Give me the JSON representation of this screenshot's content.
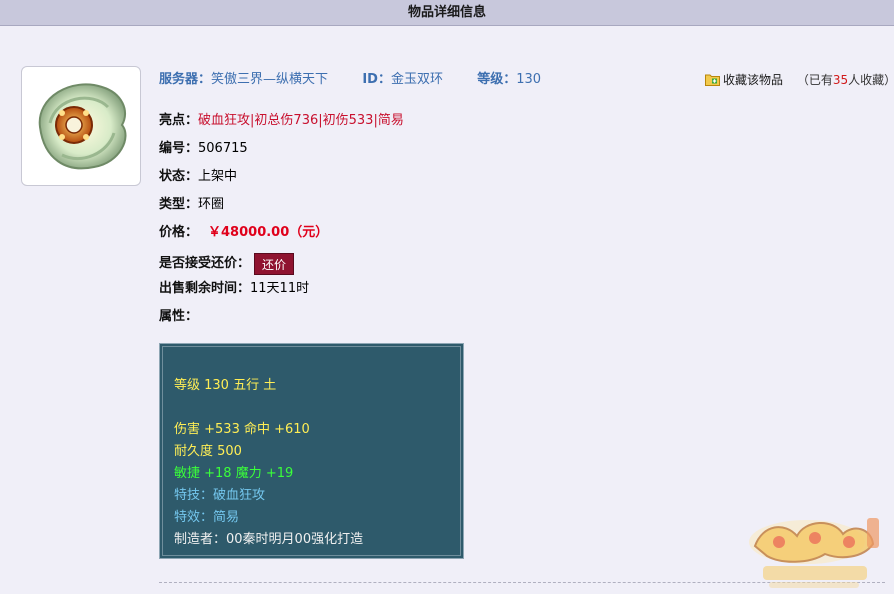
{
  "page": {
    "title": "物品详细信息"
  },
  "header": {
    "server_label": "服务器：",
    "server_value": "笑傲三界—纵横天下",
    "id_label": "ID：",
    "id_value": "金玉双环",
    "level_label": "等级：",
    "level_value": "130"
  },
  "favorite": {
    "link_label": "收藏该物品",
    "count_prefix": "（已有",
    "count": "35",
    "count_suffix": "人收藏）",
    "icon": "folder-add-icon"
  },
  "details": {
    "highlights_label": "亮点：",
    "highlights": [
      "破血狂攻",
      "初总伤736",
      "初伤533",
      "简易"
    ],
    "highlight_sep": "|",
    "serial_label": "编号：",
    "serial_value": "506715",
    "status_label": "状态：",
    "status_value": "上架中",
    "type_label": "类型：",
    "type_value": "环圈",
    "price_label": "价格：",
    "price_value": "￥48000.00（元）",
    "bargain_label": "是否接受还价：",
    "bargain_button": "还价",
    "remaining_label": "出售剩余时间：",
    "remaining_value": "11天11时",
    "attributes_label": "属性："
  },
  "attributes": {
    "line1": "等级 130 五行 土",
    "line2": "伤害 +533 命中 +610",
    "line3": "耐久度 500",
    "line4": "敏捷 +18 魔力 +19",
    "line5": "特技：破血狂攻",
    "line6": "特效：简易",
    "line7": "制造者：00秦时明月00强化打造"
  },
  "colors": {
    "accent_blue": "#3d6fb0",
    "price_red": "#e0001b",
    "highlight_red": "#c8102e",
    "attr_bg": "#2e5a6b",
    "bargain_bg": "#8f1330"
  }
}
